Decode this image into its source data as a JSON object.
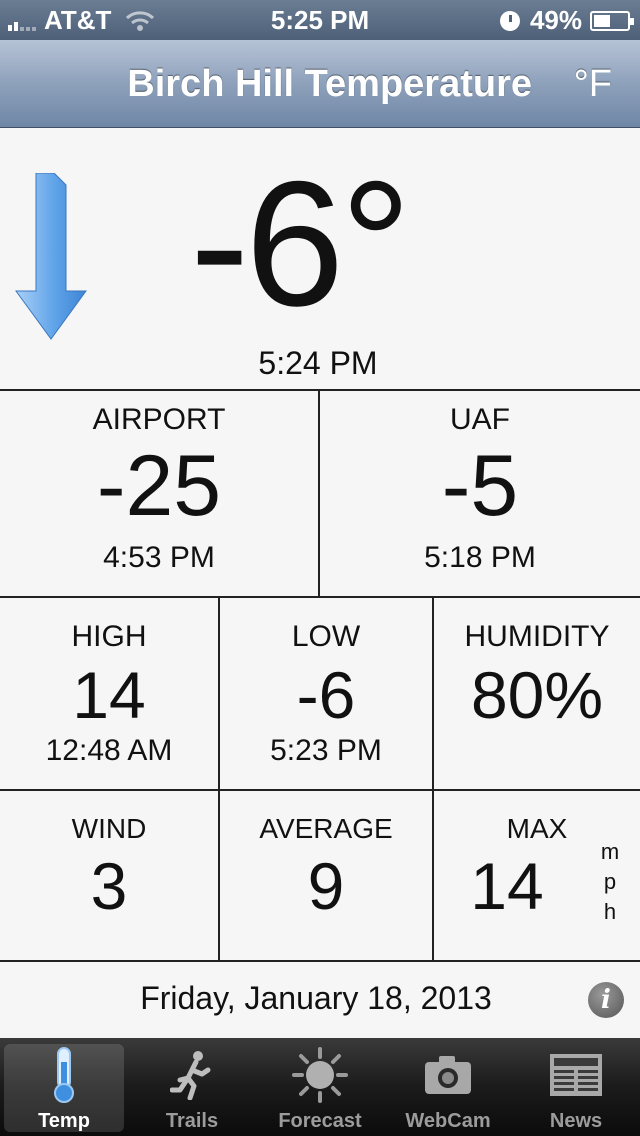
{
  "status_bar": {
    "carrier": "AT&T",
    "time": "5:25 PM",
    "battery": "49%"
  },
  "nav": {
    "title": "Birch Hill Temperature",
    "unit_button": "°F"
  },
  "current": {
    "temperature": "-6°",
    "time": "5:24 PM",
    "trend": "falling"
  },
  "stations": [
    {
      "label": "AIRPORT",
      "value": "-25",
      "time": "4:53 PM"
    },
    {
      "label": "UAF",
      "value": "-5",
      "time": "5:18 PM"
    }
  ],
  "stats": {
    "high": {
      "label": "HIGH",
      "value": "14",
      "time": "12:48 AM"
    },
    "low": {
      "label": "LOW",
      "value": "-6",
      "time": "5:23 PM"
    },
    "humidity": {
      "label": "HUMIDITY",
      "value": "80%"
    }
  },
  "wind": {
    "wind": {
      "label": "WIND",
      "value": "3"
    },
    "average": {
      "label": "AVERAGE",
      "value": "9"
    },
    "max": {
      "label": "MAX",
      "value": "14"
    },
    "unit_letters": [
      "m",
      "p",
      "h"
    ]
  },
  "date": "Friday, January 18, 2013",
  "info_icon": "i",
  "tabs": [
    {
      "label": "Temp",
      "icon": "thermometer-icon",
      "selected": true
    },
    {
      "label": "Trails",
      "icon": "runner-icon",
      "selected": false
    },
    {
      "label": "Forecast",
      "icon": "sun-icon",
      "selected": false
    },
    {
      "label": "WebCam",
      "icon": "camera-icon",
      "selected": false
    },
    {
      "label": "News",
      "icon": "newspaper-icon",
      "selected": false
    }
  ],
  "colors": {
    "arrow": "#5fa3e8",
    "nav_bar": "#8ea1bb",
    "tab_bar": "#1b1b1b"
  }
}
